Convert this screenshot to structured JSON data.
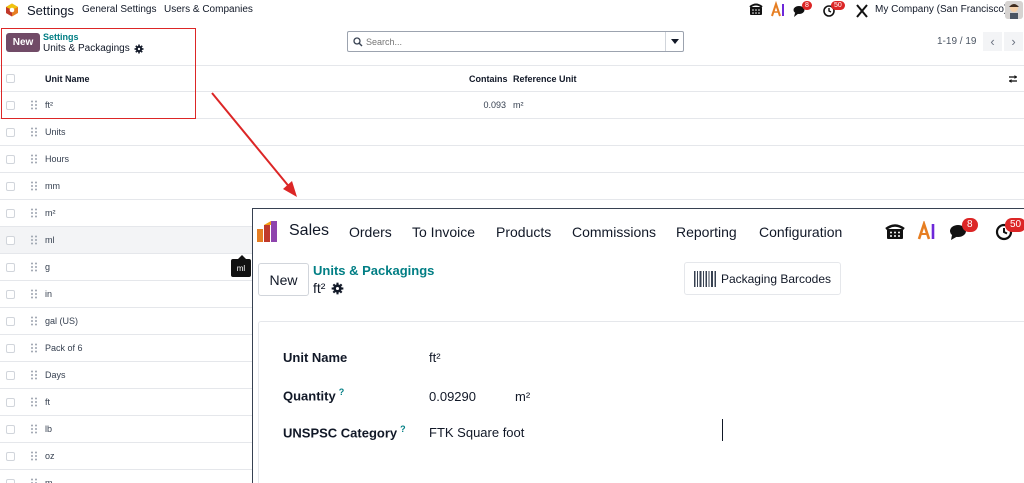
{
  "navbar": {
    "app_name": "Settings",
    "links": [
      "General Settings",
      "Users & Companies"
    ],
    "messages_badge": "8",
    "activities_badge": "50",
    "company": "My Company (San Francisco)"
  },
  "control_panel": {
    "new_label": "New",
    "breadcrumb_parent": "Settings",
    "breadcrumb_current": "Units & Packagings",
    "search_placeholder": "Search...",
    "pager": "1-19 / 19"
  },
  "list": {
    "columns": [
      "Unit Name",
      "Contains",
      "Reference Unit"
    ],
    "rows": [
      {
        "name": "ft²",
        "contains": "0.093",
        "ref": "m²"
      },
      {
        "name": "Units",
        "contains": "",
        "ref": ""
      },
      {
        "name": "Hours",
        "contains": "",
        "ref": ""
      },
      {
        "name": "mm",
        "contains": "",
        "ref": ""
      },
      {
        "name": "m²",
        "contains": "",
        "ref": ""
      },
      {
        "name": "ml",
        "contains": "",
        "ref": ""
      },
      {
        "name": "g",
        "contains": "",
        "ref": ""
      },
      {
        "name": "in",
        "contains": "",
        "ref": ""
      },
      {
        "name": "gal (US)",
        "contains": "",
        "ref": ""
      },
      {
        "name": "Pack of 6",
        "contains": "",
        "ref": ""
      },
      {
        "name": "Days",
        "contains": "",
        "ref": ""
      },
      {
        "name": "ft",
        "contains": "",
        "ref": ""
      },
      {
        "name": "lb",
        "contains": "",
        "ref": ""
      },
      {
        "name": "oz",
        "contains": "",
        "ref": ""
      },
      {
        "name": "m",
        "contains": "",
        "ref": ""
      }
    ],
    "tooltip": "ml"
  },
  "inset": {
    "app_name": "Sales",
    "nav": [
      "Orders",
      "To Invoice",
      "Products",
      "Commissions",
      "Reporting",
      "Configuration"
    ],
    "messages_badge": "8",
    "activities_badge": "50",
    "new_label": "New",
    "breadcrumb_parent": "Units & Packagings",
    "breadcrumb_current": "ft²",
    "barcode_button": "Packaging Barcodes",
    "form": {
      "unit_name_label": "Unit Name",
      "unit_name_value": "ft²",
      "quantity_label": "Quantity",
      "quantity_help": "?",
      "quantity_value": "0.09290",
      "quantity_unit": "m²",
      "unspsc_label": "UNSPSC Category",
      "unspsc_help": "?",
      "unspsc_value": "FTK Square foot"
    }
  },
  "colors": {
    "brand": "#714b67",
    "teal": "#017e84",
    "annotation_red": "#dc2626"
  }
}
